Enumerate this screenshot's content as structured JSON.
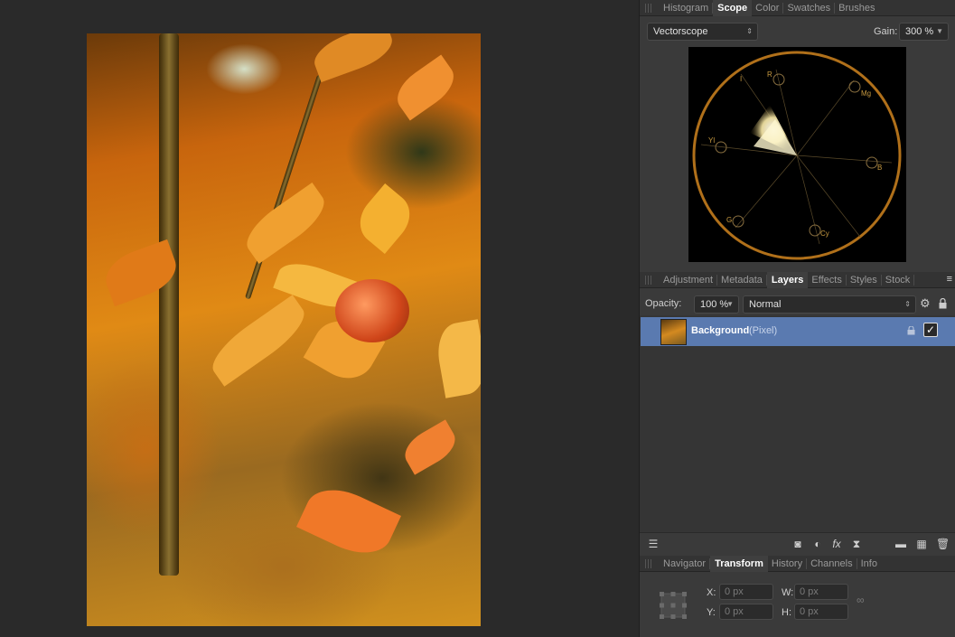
{
  "scope_panel": {
    "tabs": [
      "Histogram",
      "Scope",
      "Color",
      "Swatches",
      "Brushes"
    ],
    "active_tab": "Scope",
    "scope_type": "Vectorscope",
    "gain_label": "Gain:",
    "gain_value": "300 %",
    "targets": [
      "R",
      "Mg",
      "B",
      "Cy",
      "G",
      "Yl",
      "I"
    ]
  },
  "layers_panel": {
    "tabs": [
      "Adjustment",
      "Metadata",
      "Layers",
      "Effects",
      "Styles",
      "Stock"
    ],
    "active_tab": "Layers",
    "opacity_label": "Opacity:",
    "opacity_value": "100 %",
    "blend_mode": "Normal",
    "layers": [
      {
        "name": "Background",
        "kind": "(Pixel)",
        "visible": true,
        "locked": true
      }
    ],
    "toolbar_icons": [
      "layers-stack-icon",
      "mask-icon",
      "adjustment-icon",
      "fx-icon",
      "live-filter-icon",
      "group-icon",
      "pixel-layer-icon",
      "delete-icon"
    ],
    "fx_glyph": "fx"
  },
  "transform_panel": {
    "tabs": [
      "Navigator",
      "Transform",
      "History",
      "Channels",
      "Info"
    ],
    "active_tab": "Transform",
    "x_label": "X:",
    "y_label": "Y:",
    "w_label": "W:",
    "h_label": "H:",
    "x_placeholder": "0 px",
    "y_placeholder": "0 px",
    "w_placeholder": "0 px",
    "h_placeholder": "0 px"
  },
  "colors": {
    "selected_layer": "#5a7ab0",
    "scope_ring": "#b0701a",
    "panel_bg": "#3a3a3a"
  }
}
